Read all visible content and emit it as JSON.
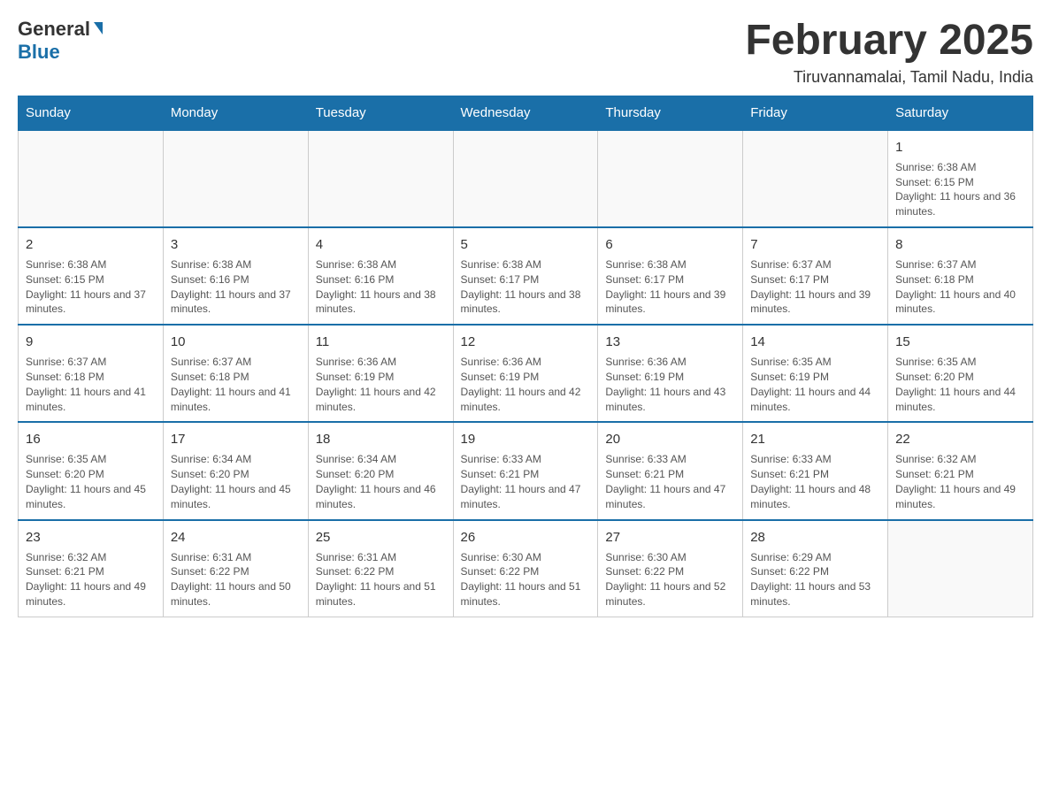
{
  "logo": {
    "general": "General",
    "blue": "Blue"
  },
  "title": "February 2025",
  "location": "Tiruvannamalai, Tamil Nadu, India",
  "days_of_week": [
    "Sunday",
    "Monday",
    "Tuesday",
    "Wednesday",
    "Thursday",
    "Friday",
    "Saturday"
  ],
  "weeks": [
    [
      {
        "day": "",
        "content": ""
      },
      {
        "day": "",
        "content": ""
      },
      {
        "day": "",
        "content": ""
      },
      {
        "day": "",
        "content": ""
      },
      {
        "day": "",
        "content": ""
      },
      {
        "day": "",
        "content": ""
      },
      {
        "day": "1",
        "content": "Sunrise: 6:38 AM\nSunset: 6:15 PM\nDaylight: 11 hours and 36 minutes."
      }
    ],
    [
      {
        "day": "2",
        "content": "Sunrise: 6:38 AM\nSunset: 6:15 PM\nDaylight: 11 hours and 37 minutes."
      },
      {
        "day": "3",
        "content": "Sunrise: 6:38 AM\nSunset: 6:16 PM\nDaylight: 11 hours and 37 minutes."
      },
      {
        "day": "4",
        "content": "Sunrise: 6:38 AM\nSunset: 6:16 PM\nDaylight: 11 hours and 38 minutes."
      },
      {
        "day": "5",
        "content": "Sunrise: 6:38 AM\nSunset: 6:17 PM\nDaylight: 11 hours and 38 minutes."
      },
      {
        "day": "6",
        "content": "Sunrise: 6:38 AM\nSunset: 6:17 PM\nDaylight: 11 hours and 39 minutes."
      },
      {
        "day": "7",
        "content": "Sunrise: 6:37 AM\nSunset: 6:17 PM\nDaylight: 11 hours and 39 minutes."
      },
      {
        "day": "8",
        "content": "Sunrise: 6:37 AM\nSunset: 6:18 PM\nDaylight: 11 hours and 40 minutes."
      }
    ],
    [
      {
        "day": "9",
        "content": "Sunrise: 6:37 AM\nSunset: 6:18 PM\nDaylight: 11 hours and 41 minutes."
      },
      {
        "day": "10",
        "content": "Sunrise: 6:37 AM\nSunset: 6:18 PM\nDaylight: 11 hours and 41 minutes."
      },
      {
        "day": "11",
        "content": "Sunrise: 6:36 AM\nSunset: 6:19 PM\nDaylight: 11 hours and 42 minutes."
      },
      {
        "day": "12",
        "content": "Sunrise: 6:36 AM\nSunset: 6:19 PM\nDaylight: 11 hours and 42 minutes."
      },
      {
        "day": "13",
        "content": "Sunrise: 6:36 AM\nSunset: 6:19 PM\nDaylight: 11 hours and 43 minutes."
      },
      {
        "day": "14",
        "content": "Sunrise: 6:35 AM\nSunset: 6:19 PM\nDaylight: 11 hours and 44 minutes."
      },
      {
        "day": "15",
        "content": "Sunrise: 6:35 AM\nSunset: 6:20 PM\nDaylight: 11 hours and 44 minutes."
      }
    ],
    [
      {
        "day": "16",
        "content": "Sunrise: 6:35 AM\nSunset: 6:20 PM\nDaylight: 11 hours and 45 minutes."
      },
      {
        "day": "17",
        "content": "Sunrise: 6:34 AM\nSunset: 6:20 PM\nDaylight: 11 hours and 45 minutes."
      },
      {
        "day": "18",
        "content": "Sunrise: 6:34 AM\nSunset: 6:20 PM\nDaylight: 11 hours and 46 minutes."
      },
      {
        "day": "19",
        "content": "Sunrise: 6:33 AM\nSunset: 6:21 PM\nDaylight: 11 hours and 47 minutes."
      },
      {
        "day": "20",
        "content": "Sunrise: 6:33 AM\nSunset: 6:21 PM\nDaylight: 11 hours and 47 minutes."
      },
      {
        "day": "21",
        "content": "Sunrise: 6:33 AM\nSunset: 6:21 PM\nDaylight: 11 hours and 48 minutes."
      },
      {
        "day": "22",
        "content": "Sunrise: 6:32 AM\nSunset: 6:21 PM\nDaylight: 11 hours and 49 minutes."
      }
    ],
    [
      {
        "day": "23",
        "content": "Sunrise: 6:32 AM\nSunset: 6:21 PM\nDaylight: 11 hours and 49 minutes."
      },
      {
        "day": "24",
        "content": "Sunrise: 6:31 AM\nSunset: 6:22 PM\nDaylight: 11 hours and 50 minutes."
      },
      {
        "day": "25",
        "content": "Sunrise: 6:31 AM\nSunset: 6:22 PM\nDaylight: 11 hours and 51 minutes."
      },
      {
        "day": "26",
        "content": "Sunrise: 6:30 AM\nSunset: 6:22 PM\nDaylight: 11 hours and 51 minutes."
      },
      {
        "day": "27",
        "content": "Sunrise: 6:30 AM\nSunset: 6:22 PM\nDaylight: 11 hours and 52 minutes."
      },
      {
        "day": "28",
        "content": "Sunrise: 6:29 AM\nSunset: 6:22 PM\nDaylight: 11 hours and 53 minutes."
      },
      {
        "day": "",
        "content": ""
      }
    ]
  ]
}
